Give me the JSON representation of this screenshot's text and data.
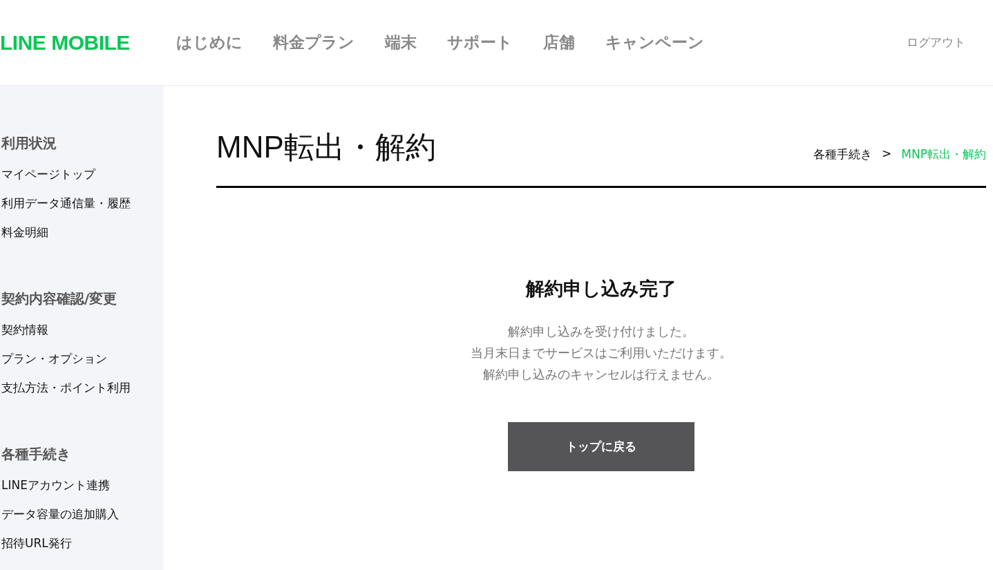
{
  "header": {
    "logo": "LINE MOBILE",
    "nav": [
      "はじめに",
      "料金プラン",
      "端末",
      "サポート",
      "店舗",
      "キャンペーン"
    ],
    "logout": "ログアウト"
  },
  "sidebar": [
    {
      "title": "利用状況",
      "items": [
        "マイページトップ",
        "利用データ通信量・履歴",
        "料金明細"
      ]
    },
    {
      "title": "契約内容確認/変更",
      "items": [
        "契約情報",
        "プラン・オプション",
        "支払方法・ポイント利用"
      ]
    },
    {
      "title": "各種手続き",
      "items": [
        "LINEアカウント連携",
        "データ容量の追加購入",
        "招待URL発行"
      ]
    }
  ],
  "page": {
    "title": "MNP転出・解約",
    "breadcrumb": {
      "separator": ">",
      "items": [
        {
          "label": "各種手続き",
          "selected": false
        },
        {
          "label": "MNP転出・解約",
          "selected": true
        }
      ]
    }
  },
  "result": {
    "heading": "解約申し込み完了",
    "lines": [
      "解約申し込みを受け付けました。",
      "当月末日までサービスはご利用いただけます。",
      "解約申し込みのキャンセルは行えません。"
    ],
    "button": "トップに戻る"
  }
}
